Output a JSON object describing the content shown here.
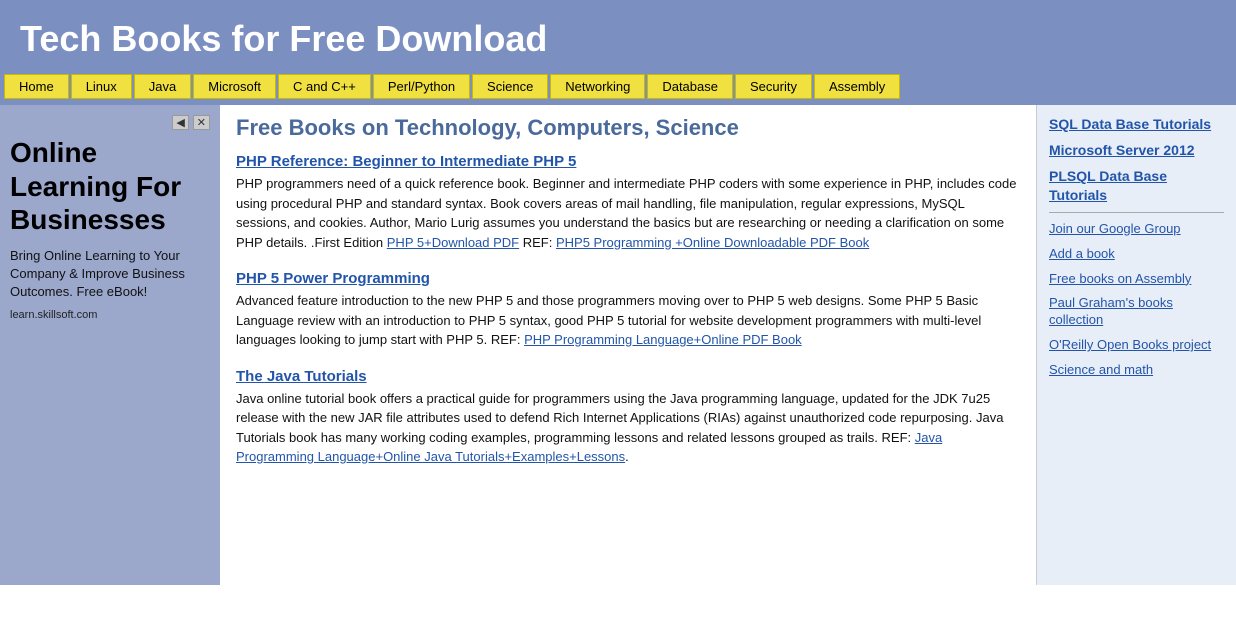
{
  "header": {
    "title": "Tech Books for Free Download"
  },
  "nav": {
    "items": [
      {
        "label": "Home",
        "href": "#"
      },
      {
        "label": "Linux",
        "href": "#"
      },
      {
        "label": "Java",
        "href": "#"
      },
      {
        "label": "Microsoft",
        "href": "#"
      },
      {
        "label": "C and C++",
        "href": "#"
      },
      {
        "label": "Perl/Python",
        "href": "#"
      },
      {
        "label": "Science",
        "href": "#"
      },
      {
        "label": "Networking",
        "href": "#"
      },
      {
        "label": "Database",
        "href": "#"
      },
      {
        "label": "Security",
        "href": "#"
      },
      {
        "label": "Assembly",
        "href": "#"
      }
    ]
  },
  "ad": {
    "main_text": "Online Learning For Businesses",
    "sub_text": "Bring Online Learning to Your Company & Improve Business Outcomes. Free eBook!",
    "footer": "learn.skillsoft.com"
  },
  "main": {
    "heading": "Free Books on Technology, Computers, Science",
    "books": [
      {
        "title": "PHP Reference: Beginner to Intermediate PHP 5",
        "description": "PHP programmers need of a quick reference book. Beginner and intermediate PHP coders with some experience in PHP, includes code using procedural PHP and standard syntax. Book covers areas of mail handling, file manipulation, regular expressions, MySQL sessions, and cookies. Author, Mario Lurig assumes you understand the basics but are researching or needing a clarification on some PHP details. .First Edition",
        "links": [
          {
            "text": "PHP 5+Download PDF",
            "href": "#"
          },
          {
            "text": "PHP5 Programming +Online Downloadable PDF Book",
            "href": "#"
          }
        ],
        "ref_prefix": " REF: ",
        "ref_sep": " REF: "
      },
      {
        "title": "PHP 5 Power Programming",
        "description": "Advanced feature introduction to the new PHP 5 and those programmers moving over to PHP 5 web designs. Some PHP 5 Basic Language review with an introduction to PHP 5 syntax, good PHP 5 tutorial for website development programmers with multi-level languages looking to jump start with PHP 5. REF:",
        "links": [
          {
            "text": "PHP Programming Language+Online PDF Book",
            "href": "#"
          }
        ]
      },
      {
        "title": "The Java Tutorials",
        "description": "Java online tutorial book offers a practical guide for programmers using the Java programming language, updated for the JDK 7u25 release with the new JAR file attributes used to defend Rich Internet Applications (RIAs) against unauthorized code repurposing. Java Tutorials book has many working coding examples, programming lessons and related lessons grouped as trails. REF:",
        "links": [
          {
            "text": "Java Programming Language+Online Java Tutorials+Examples+Lessons",
            "href": "#"
          }
        ]
      }
    ]
  },
  "right_sidebar": {
    "bold_links": [
      {
        "text": "SQL Data Base Tutorials",
        "href": "#"
      },
      {
        "text": "Microsoft Server 2012",
        "href": "#"
      },
      {
        "text": "PLSQL Data Base Tutorials",
        "href": "#"
      }
    ],
    "plain_links": [
      {
        "text": "Join our Google Group",
        "href": "#"
      },
      {
        "text": "Add a book",
        "href": "#"
      },
      {
        "text": "Free books on Assembly",
        "href": "#"
      },
      {
        "text": "Paul Graham's books collection",
        "href": "#"
      },
      {
        "text": "O'Reilly Open Books project",
        "href": "#"
      },
      {
        "text": "Science and math",
        "href": "#"
      }
    ]
  }
}
